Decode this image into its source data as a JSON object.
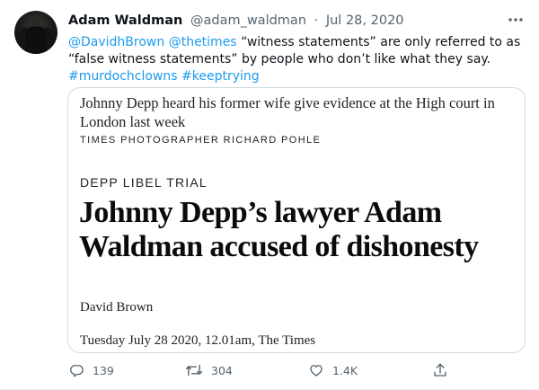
{
  "tweet": {
    "author_name": "Adam Waldman",
    "handle": "@adam_waldman",
    "separator": "·",
    "date": "Jul 28, 2020",
    "text": {
      "mention1": "@DavidhBrown",
      "mention2": "@thetimes",
      "body": "“witness statements” are only referred to as “false witness statements” by people who don’t like what they say.",
      "hashtag1": "#murdochclowns",
      "hashtag2": "#keeptrying"
    },
    "accent_color": "#1d9bf0"
  },
  "card": {
    "caption": "Johnny Depp heard his former wife give evidence at the High court in London last week",
    "credit": "TIMES PHOTOGRAPHER RICHARD POHLE",
    "kicker": "DEPP LIBEL TRIAL",
    "headline": "Johnny Depp’s lawyer Adam Waldman accused of dishonesty",
    "byline": "David Brown",
    "dateline": "Tuesday July 28 2020, 12.01am, The Times"
  },
  "actions": {
    "reply_icon": "reply-icon",
    "reply_count": "139",
    "retweet_icon": "retweet-icon",
    "retweet_count": "304",
    "like_icon": "heart-icon",
    "like_count": "1.4K",
    "share_icon": "share-icon"
  }
}
